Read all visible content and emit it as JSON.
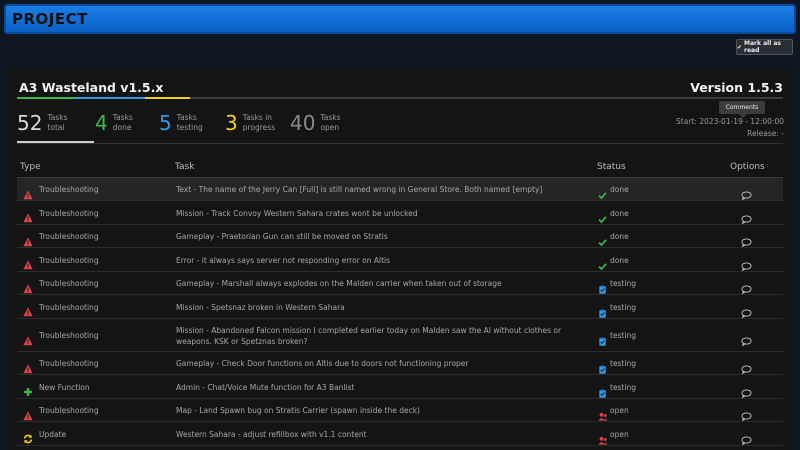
{
  "topbar": {
    "title": "Project"
  },
  "actions": {
    "mark_all_label": "Mark all as read"
  },
  "project": {
    "name": "A3 Wasteland v1.5.x",
    "version": "Version 1.5.3",
    "start": "Start: 2023-01-19 - 12:00:00",
    "release": "Release: -"
  },
  "stats": [
    {
      "num": "52",
      "label": "Tasks total",
      "color": "#d8d8d8"
    },
    {
      "num": "4",
      "label": "Tasks done",
      "color": "#3db84a"
    },
    {
      "num": "5",
      "label": "Tasks testing",
      "color": "#2f9be8"
    },
    {
      "num": "3",
      "label": "Tasks in progress",
      "color": "#f2d01a"
    },
    {
      "num": "40",
      "label": "Tasks open",
      "color": "#8a8a8a"
    }
  ],
  "table": {
    "headers": {
      "type": "Type",
      "task": "Task",
      "status": "Status",
      "options": "Options"
    },
    "tooltip": "Comments",
    "rows": [
      {
        "type": "Troubleshooting",
        "task": "Text - The name of the Jerry Can [Full] is still named wrong in General Store. Both named [empty]",
        "status": "done"
      },
      {
        "type": "Troubleshooting",
        "task": "Mission - Track Convoy Western Sahara crates wont be unlocked",
        "status": "done"
      },
      {
        "type": "Troubleshooting",
        "task": "Gameplay - Praetorian Gun can still be moved on Stratis",
        "status": "done"
      },
      {
        "type": "Troubleshooting",
        "task": "Error - it always says server not responding error on Altis",
        "status": "done"
      },
      {
        "type": "Troubleshooting",
        "task": "Gameplay - Marshall always explodes on the Malden carrier when taken out of storage",
        "status": "testing"
      },
      {
        "type": "Troubleshooting",
        "task": "Mission - Spetsnaz broken in Western Sahara",
        "status": "testing"
      },
      {
        "type": "Troubleshooting",
        "task": "Mission - Abandoned Falcon mission I completed earlier today on Malden saw the AI without clothes or weapons. KSK or Spetznas broken?",
        "status": "testing"
      },
      {
        "type": "Troubleshooting",
        "task": "Gameplay - Check Door functions on Altis due to doors not functioning proper",
        "status": "testing"
      },
      {
        "type": "New Function",
        "task": "Admin - Chat/Voice Mute function for A3 Banlist",
        "status": "testing"
      },
      {
        "type": "Troubleshooting",
        "task": "Map - Land Spawn bug on Stratis Carrier (spawn inside the deck)",
        "status": "open"
      },
      {
        "type": "Update",
        "task": "Western Sahara - adjust refillbox with v1.1 content",
        "status": "open"
      }
    ]
  },
  "colors": {
    "done": "#3db84a",
    "testing": "#2f9be8",
    "open": "#e04646",
    "troubleshooting": "#e04646",
    "new_function": "#3db84a",
    "update": "#f2d01a"
  }
}
